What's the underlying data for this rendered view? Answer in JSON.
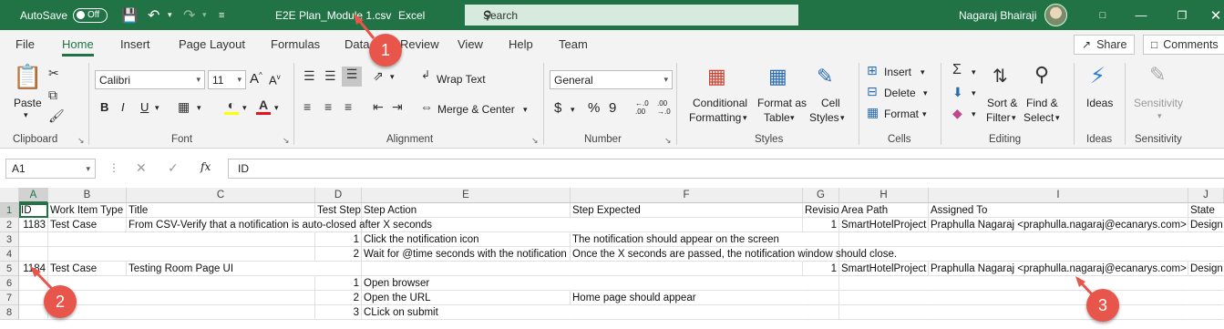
{
  "titlebar": {
    "autosave_label": "AutoSave",
    "autosave_state": "Off",
    "filename": "E2E Plan_Module 1.csv",
    "app_name": "Excel",
    "search_placeholder": "Search",
    "user_name": "Nagaraj Bhairaji",
    "accent_color": "#217346"
  },
  "tabs": [
    "File",
    "Home",
    "Insert",
    "Page Layout",
    "Formulas",
    "Data",
    "Review",
    "View",
    "Help",
    "Team"
  ],
  "active_tab": "Home",
  "share_label": "Share",
  "comments_label": "Comments",
  "ribbon": {
    "clipboard": {
      "paste": "Paste",
      "label": "Clipboard"
    },
    "font": {
      "family": "Calibri",
      "size": "11",
      "label": "Font",
      "bold": "B",
      "italic": "I",
      "underline": "U",
      "grow": "A",
      "shrink": "A"
    },
    "alignment": {
      "wrap": "Wrap Text",
      "merge": "Merge & Center",
      "label": "Alignment"
    },
    "number": {
      "format": "General",
      "currency": "$",
      "percent": "%",
      "comma": "9",
      "label": "Number"
    },
    "styles": {
      "conditional_1": "Conditional",
      "conditional_2": "Formatting",
      "table_1": "Format as",
      "table_2": "Table",
      "cell_1": "Cell",
      "cell_2": "Styles",
      "label": "Styles"
    },
    "cells": {
      "insert": "Insert",
      "delete": "Delete",
      "format": "Format",
      "label": "Cells"
    },
    "editing": {
      "sort_1": "Sort &",
      "sort_2": "Filter",
      "find_1": "Find &",
      "find_2": "Select",
      "label": "Editing"
    },
    "ideas": {
      "btn": "Ideas",
      "label": "Ideas"
    },
    "sensitivity": {
      "btn": "Sensitivity",
      "label": "Sensitivity"
    }
  },
  "formula_bar": {
    "cell_ref": "A1",
    "fx": "fx",
    "content": "ID"
  },
  "columns": [
    "A",
    "B",
    "C",
    "D",
    "E",
    "F",
    "G",
    "H",
    "I",
    "J"
  ],
  "rows": [
    "1",
    "2",
    "3",
    "4",
    "5",
    "6",
    "7",
    "8"
  ],
  "cells": {
    "r1": [
      "ID",
      "Work Item Type",
      "Title",
      "Test Step",
      "Step Action",
      "Step Expected",
      "Revision",
      "Area Path",
      "Assigned To",
      "State"
    ],
    "r2": [
      "1183",
      "Test Case",
      "From CSV-Verify that a notification is auto-closed after X seconds",
      "",
      "",
      "",
      "1",
      "SmartHotelProject",
      "Praphulla Nagaraj <praphulla.nagaraj@ecanarys.com>",
      "Design"
    ],
    "r3": [
      "",
      "",
      "",
      "1",
      "Click the notification icon",
      "The notification should appear on the screen",
      "",
      "",
      "",
      ""
    ],
    "r4": [
      "",
      "",
      "",
      "2",
      "Wait for @time  seconds with the notification",
      "Once the X seconds are passed, the notification window should close.",
      "",
      "",
      "",
      ""
    ],
    "r5": [
      "1184",
      "Test Case",
      "Testing Room Page UI",
      "",
      "",
      "",
      "1",
      "SmartHotelProject",
      "Praphulla Nagaraj <praphulla.nagaraj@ecanarys.com>",
      "Design"
    ],
    "r6": [
      "",
      "",
      "",
      "1",
      "Open browser",
      "",
      "",
      "",
      "",
      ""
    ],
    "r7": [
      "",
      "",
      "",
      "2",
      "Open the URL",
      "Home page should appear",
      "",
      "",
      "",
      ""
    ],
    "r8": [
      "",
      "",
      "",
      "3",
      "CLick on submit",
      "",
      "",
      "",
      "",
      ""
    ]
  },
  "callouts": [
    "1",
    "2",
    "3"
  ]
}
